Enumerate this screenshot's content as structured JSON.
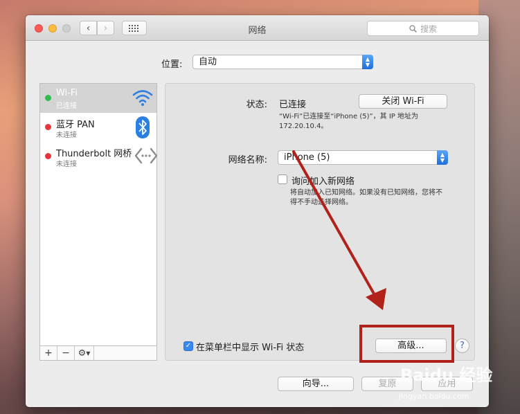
{
  "window": {
    "title": "网络"
  },
  "search": {
    "placeholder": "搜索"
  },
  "location": {
    "label": "位置:",
    "value": "自动"
  },
  "services": [
    {
      "name": "Wi-Fi",
      "status": "已连接",
      "dot_color": "#2ebd4b",
      "icon": "wifi-icon",
      "selected": true
    },
    {
      "name": "蓝牙 PAN",
      "status": "未连接",
      "dot_color": "#e8343b",
      "icon": "bluetooth-icon",
      "selected": false
    },
    {
      "name": "Thunderbolt 网桥",
      "status": "未连接",
      "dot_color": "#e8343b",
      "icon": "thunderbolt-bridge-icon",
      "selected": false
    }
  ],
  "sidebar_tools": {
    "add": "+",
    "remove": "−",
    "gear": "gear-icon"
  },
  "panel": {
    "status_label": "状态:",
    "status_value": "已连接",
    "wifi_off_button": "关闭 Wi-Fi",
    "status_desc_1": "“Wi-Fi”已连接至“iPhone (5)”，其 IP 地址为",
    "status_desc_2": "172.20.10.4。",
    "network_name_label": "网络名称:",
    "network_name_value": "iPhone (5)",
    "ask_join_label": "询问加入新网络",
    "ask_join_checked": false,
    "ask_join_desc_1": "将自动加入已知网络。如果没有已知网络，您将不",
    "ask_join_desc_2": "得不手动选择网络。",
    "show_menubar_label": "在菜单栏中显示 Wi-Fi 状态",
    "show_menubar_checked": true,
    "advanced_button": "高级...",
    "help_button": "?"
  },
  "footer": {
    "assistant_button": "向导...",
    "revert_button": "复原",
    "apply_button": "应用"
  },
  "annotation": {
    "color": "#b0221a"
  },
  "watermark": {
    "text": "Baidu 经验",
    "url": "jingyan.baidu.com"
  }
}
